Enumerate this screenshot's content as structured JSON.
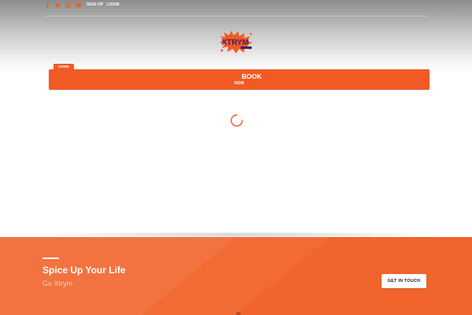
{
  "topbar": {
    "social_icons": [
      "facebook-icon",
      "twitter-icon",
      "instagram-icon",
      "youtube-icon"
    ],
    "sign_up": "SIGN UP",
    "login": "LOGIN"
  },
  "logo": {
    "text": "XTRYM",
    "alt_subtext": "ADVENTURES"
  },
  "nav": {
    "home_label": "HOME",
    "book_line1": "BOOK",
    "book_line2": "NOW"
  },
  "loader": {
    "icon": "spinner-icon"
  },
  "footer": {
    "title": "Spice Up Your Life",
    "subtitle": "Go Xtrym",
    "cta_label": "GET IN TOUCH"
  },
  "colors": {
    "accent": "#f15a24",
    "footer_bg": "#f26b35",
    "header_top": "#8c8c8c"
  }
}
